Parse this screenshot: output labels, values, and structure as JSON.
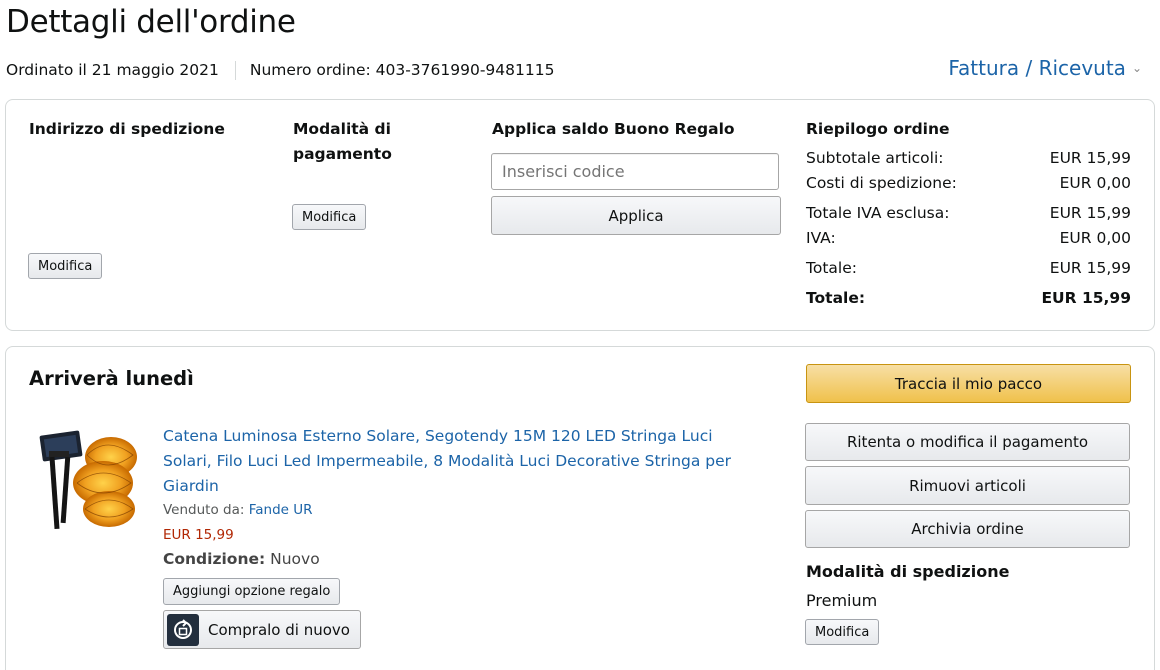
{
  "header": {
    "title": "Dettagli dell'ordine",
    "ordered_on": "Ordinato il 21 maggio 2021",
    "order_number": "Numero ordine: 403-3761990-9481115",
    "invoice_link": "Fattura / Ricevuta"
  },
  "shipping_address": {
    "heading": "Indirizzo di spedizione",
    "edit_label": "Modifica"
  },
  "payment": {
    "heading_line1": "Modalità di",
    "heading_line2": "pagamento",
    "edit_label": "Modifica"
  },
  "gift_card": {
    "heading": "Applica saldo Buono Regalo",
    "placeholder": "Inserisci codice",
    "apply_label": "Applica"
  },
  "summary": {
    "heading": "Riepilogo ordine",
    "rows": [
      {
        "label": "Subtotale articoli:",
        "value": "EUR 15,99"
      },
      {
        "label": "Costi di spedizione:",
        "value": "EUR 0,00"
      },
      {
        "label": "Totale IVA esclusa:",
        "value": "EUR 15,99"
      },
      {
        "label": "IVA:",
        "value": "EUR 0,00"
      },
      {
        "label": "Totale:",
        "value": "EUR 15,99"
      },
      {
        "label": "Totale:",
        "value": "EUR 15,99"
      }
    ]
  },
  "shipment": {
    "arrival": "Arriverà lunedì",
    "item": {
      "title_line1": "Catena Luminosa Esterno Solare, Segotendy 15M 120 LED Stringa Luci",
      "title_line2": "Solari, Filo Luci Led Impermeabile, 8 Modalità Luci Decorative Stringa per",
      "title_line3": "Giardin",
      "sold_by_label": "Venduto da:",
      "seller": "Fande UR",
      "price": "EUR 15,99",
      "condition_label": "Condizione:",
      "condition_value": "Nuovo",
      "gift_option_label": "Aggiungi opzione regalo",
      "buy_again_label": "Compralo di nuovo"
    },
    "actions": {
      "track": "Traccia il mio pacco",
      "retry_payment": "Ritenta o modifica il pagamento",
      "remove_items": "Rimuovi articoli",
      "archive": "Archivia ordine"
    },
    "shipping_method": {
      "heading": "Modalità di spedizione",
      "value": "Premium",
      "edit_label": "Modifica"
    }
  },
  "colors": {
    "link": "#1c64a8",
    "price": "#b12704",
    "accent_button": "#f0c14b"
  }
}
